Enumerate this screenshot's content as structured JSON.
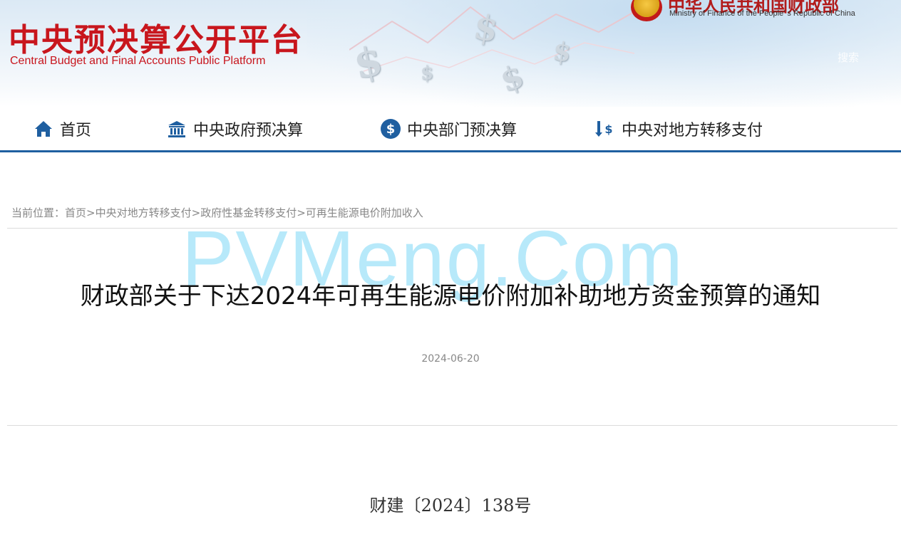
{
  "header": {
    "site_title_cn": "中央预决算公开平台",
    "site_title_en": "Central Budget and Final Accounts Public Platform",
    "ministry_cn": "中华人民共和国财政部",
    "ministry_en": "Ministry of Finance of the People' s Republic of China",
    "search_hint": "搜索",
    "brand_color": "#c8161d"
  },
  "nav": {
    "items": [
      {
        "label": "首页",
        "icon": "home-icon"
      },
      {
        "label": "中央政府预决算",
        "icon": "government-building-icon"
      },
      {
        "label": "中央部门预决算",
        "icon": "dollar-circle-icon"
      },
      {
        "label": "中央对地方转移支付",
        "icon": "transfer-arrows-icon"
      }
    ],
    "accent_color": "#1f5fa0"
  },
  "breadcrumb": {
    "prefix": "当前位置：",
    "items": [
      "首页",
      "中央对地方转移支付",
      "政府性基金转移支付",
      "可再生能源电价附加收入"
    ],
    "separator": ">"
  },
  "watermark": "PVMeng.Com",
  "article": {
    "title": "财政部关于下达2024年可再生能源电价附加补助地方资金预算的通知",
    "date": "2024-06-20",
    "doc_number": "财建〔2024〕138号"
  }
}
